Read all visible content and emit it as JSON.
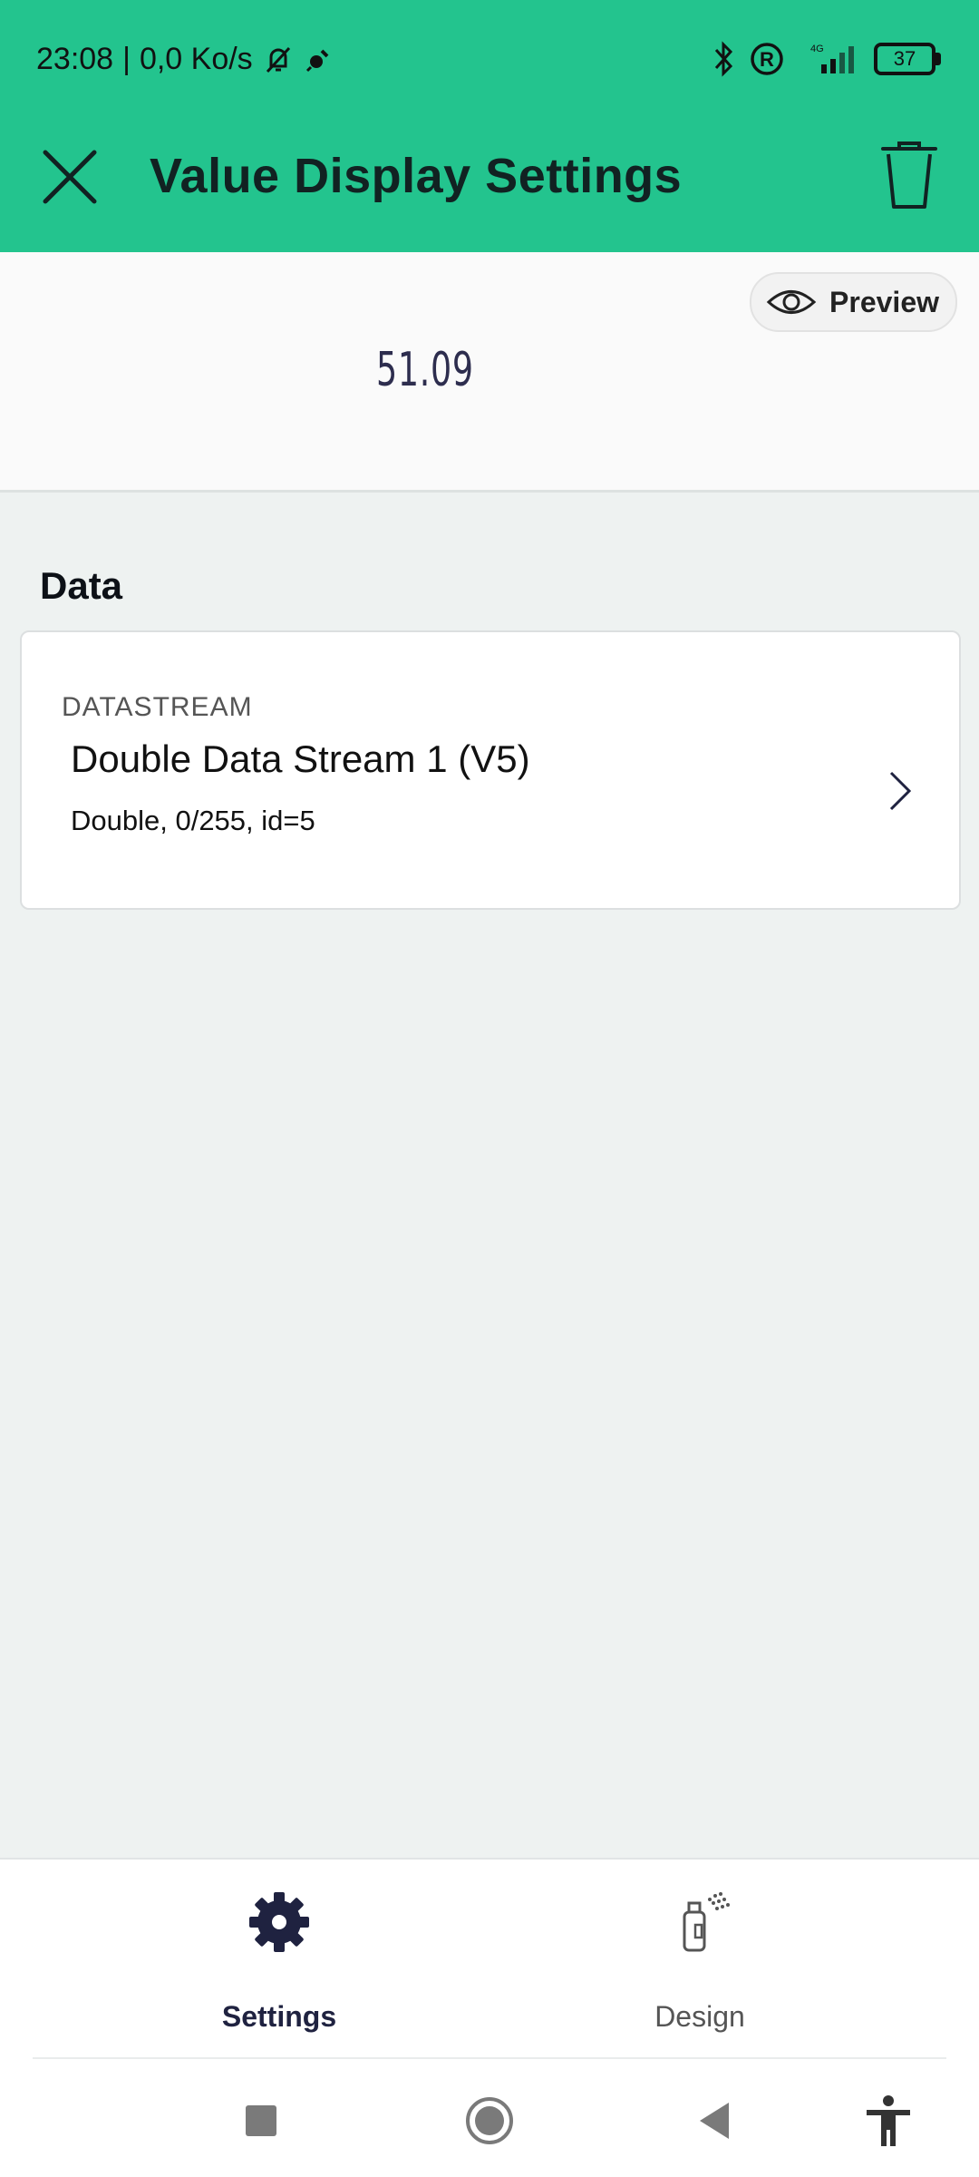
{
  "status_bar": {
    "time": "23:08",
    "speed": "0,0 Ko/s",
    "battery": "37",
    "network": "4G"
  },
  "toolbar": {
    "title": "Value Display Settings"
  },
  "preview": {
    "button_label": "Preview",
    "value": "51.09"
  },
  "data_section": {
    "title": "Data",
    "datastream": {
      "label": "DATASTREAM",
      "name": "Double Data Stream 1 (V5)",
      "meta": "Double, 0/255, id=5"
    }
  },
  "bottom_nav": {
    "tabs": [
      {
        "label": "Settings",
        "icon": "gear-icon",
        "active": true
      },
      {
        "label": "Design",
        "icon": "spray-paint-icon",
        "active": false
      }
    ]
  },
  "colors": {
    "header": "#23c48e",
    "active_tab": "#1f2240"
  }
}
